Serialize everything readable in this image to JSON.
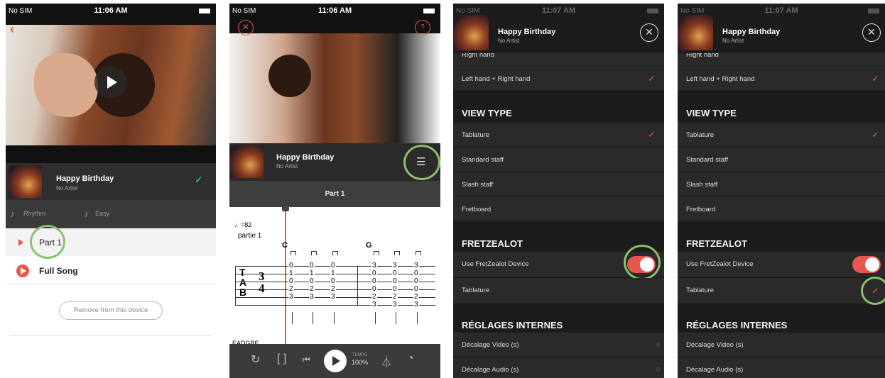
{
  "status": {
    "carrier": "No SIM",
    "time1": "11:06 AM",
    "time2": "11:06 AM",
    "time3": "11:07 AM",
    "time4": "11:07 AM"
  },
  "song": {
    "title": "Happy Birthday",
    "artist": "No Artist"
  },
  "screen1": {
    "back_label": "Back",
    "style": "Rhythm",
    "difficulty": "Easy",
    "part1": "Part 1",
    "full_song": "Full Song",
    "remove": "Remove from this device"
  },
  "screen2": {
    "part_title": "Part 1",
    "help": "?",
    "tempo_bpm": "♩=82",
    "section": "partie 1",
    "chord1": "C",
    "chord2": "G",
    "tab_t": "T",
    "tab_a": "A",
    "tab_b": "B",
    "tuning": "EADGBE",
    "tempo_label": "TEMPO",
    "tempo_value": "100%",
    "tab_cols": [
      [
        "0",
        "1",
        "0",
        "2",
        "3",
        ""
      ],
      [
        "0",
        "1",
        "0",
        "2",
        "3",
        ""
      ],
      [
        "0",
        "1",
        "0",
        "2",
        "3",
        ""
      ],
      [
        "3",
        "0",
        "0",
        "0",
        "2",
        "3"
      ],
      [
        "3",
        "0",
        "0",
        "0",
        "2",
        "3"
      ],
      [
        "3",
        "0",
        "0",
        "0",
        "2",
        "3"
      ]
    ]
  },
  "settings": {
    "right_hand": "Right hand",
    "left_right": "Left hand + Right hand",
    "view_type": "VIEW TYPE",
    "tablature": "Tablature",
    "standard": "Standard staff",
    "slash": "Slash staff",
    "fretboard": "Fretboard",
    "fretzealot": "FRETZEALOT",
    "use_fz": "Use FretZealot Device",
    "fz_tab": "Tablature",
    "internal": "RÉGLAGES INTERNES",
    "video_offset": "Décalage Video (s)",
    "audio_offset": "Décalage Audio (s)",
    "video_val": "0",
    "audio_val": "0"
  },
  "colors": {
    "accent": "#e7564f",
    "highlight_ring": "#8ac06a",
    "check_green": "#33d17a"
  }
}
